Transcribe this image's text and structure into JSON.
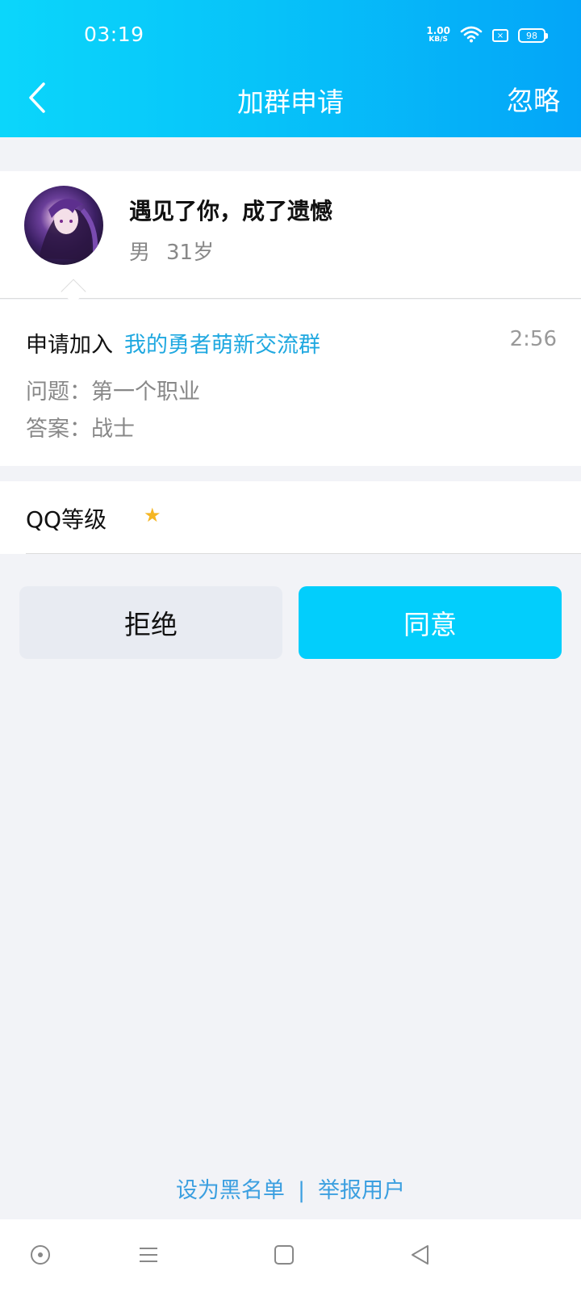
{
  "status_bar": {
    "time": "03:19",
    "net_speed_value": "1.00",
    "net_speed_unit": "KB/S",
    "battery_level": "98",
    "icons": [
      "wifi-icon",
      "sim-icon",
      "battery-icon"
    ]
  },
  "header": {
    "title": "加群申请",
    "ignore_label": "忽略",
    "back_icon": "chevron-left-icon"
  },
  "profile": {
    "nickname": "遇见了你，成了遗憾",
    "gender": "男",
    "age": "31岁"
  },
  "request": {
    "prefix": "申请加入",
    "group_name": "我的勇者萌新交流群",
    "time": "2:56",
    "question": "问题：第一个职业",
    "answer": "答案：战士"
  },
  "qq_level": {
    "label": "QQ等级",
    "stars": 1,
    "star_glyph": "★"
  },
  "actions": {
    "reject_label": "拒绝",
    "accept_label": "同意"
  },
  "footer": {
    "blacklist_label": "设为黑名单",
    "separator": "|",
    "report_label": "举报用户"
  },
  "colors": {
    "header_start": "#0bd6fb",
    "header_end": "#04a5f8",
    "link": "#1fa8e0",
    "accept_bg": "#02cefc",
    "reject_bg": "#e8ebf2",
    "page_bg": "#f2f3f7"
  },
  "nav_bar": {
    "icons": [
      "home-circle-icon",
      "menu-icon",
      "square-icon",
      "back-triangle-icon"
    ]
  }
}
